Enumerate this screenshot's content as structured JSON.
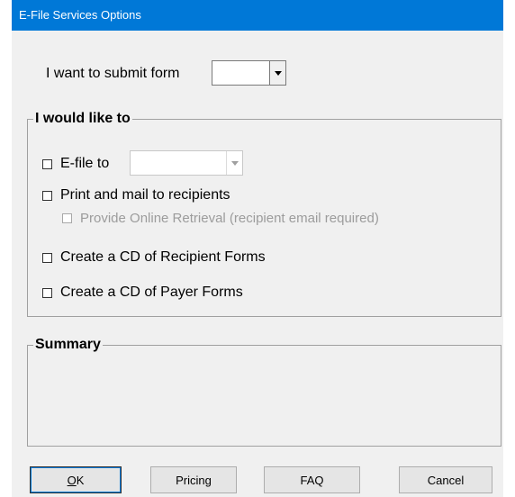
{
  "window": {
    "title": "E-File Services Options"
  },
  "submit_form": {
    "label": "I want to submit form",
    "value": ""
  },
  "options_group": {
    "legend": "I would like to",
    "efile": {
      "label": "E-file to",
      "checked": false,
      "target_value": ""
    },
    "print_mail": {
      "label": "Print and mail to recipients",
      "checked": false
    },
    "online_retrieval": {
      "label": "Provide Online Retrieval  (recipient email required)",
      "checked": false,
      "enabled": false
    },
    "cd_recipient": {
      "label": "Create a CD of Recipient Forms",
      "checked": false
    },
    "cd_payer": {
      "label": "Create a CD of Payer Forms",
      "checked": false
    }
  },
  "summary_group": {
    "legend": "Summary",
    "text": ""
  },
  "buttons": {
    "ok": "OK",
    "pricing": "Pricing",
    "faq": "FAQ",
    "cancel": "Cancel"
  },
  "colors": {
    "titlebar": "#0078d7",
    "dialog_bg": "#f0f0f0",
    "disabled_text": "#9c9c9c"
  }
}
